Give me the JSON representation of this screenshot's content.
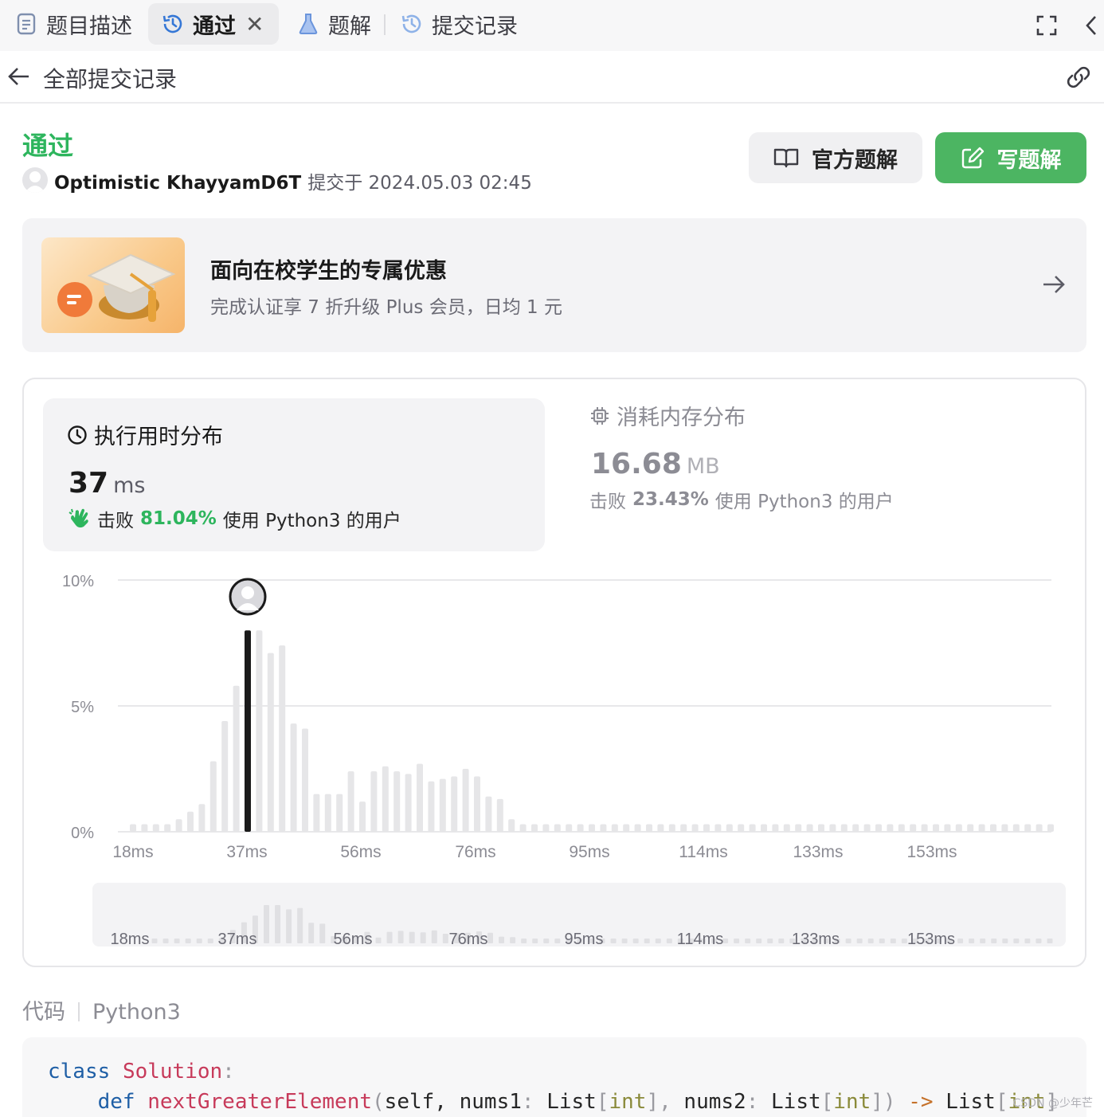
{
  "tabs": [
    {
      "label": "题目描述",
      "icon": "document-icon"
    },
    {
      "label": "通过",
      "icon": "history-icon",
      "active": true,
      "closable": true
    },
    {
      "label": "题解",
      "icon": "flask-icon"
    },
    {
      "label": "提交记录",
      "icon": "history-icon"
    }
  ],
  "header": {
    "title": "全部提交记录"
  },
  "submission": {
    "status": "通过",
    "user": "Optimistic KhayyamD6T",
    "submitted_label": "提交于 2024.05.03 02:45"
  },
  "buttons": {
    "official": "官方题解",
    "write": "写题解"
  },
  "promo": {
    "title": "面向在校学生的专属优惠",
    "subtitle": "完成认证享 7 折升级 Plus 会员，日均 1 元"
  },
  "runtime": {
    "title": "执行用时分布",
    "value": "37",
    "unit": "ms",
    "beat_prefix": "击败",
    "beat_pct": "81.04%",
    "beat_suffix": "使用 Python3 的用户"
  },
  "memory": {
    "title": "消耗内存分布",
    "value": "16.68",
    "unit": "MB",
    "beat_prefix": "击败",
    "beat_pct": "23.43%",
    "beat_suffix": "使用 Python3 的用户"
  },
  "colors": {
    "accent_green": "#2db55d",
    "button_green": "#4cb562",
    "selected_bar": "#1a1a1a",
    "bar": "#e6e6e8"
  },
  "chart_data": {
    "type": "bar",
    "title": "",
    "xlabel": "",
    "ylabel": "",
    "y_ticks": [
      "10%",
      "5%",
      "0%"
    ],
    "ylim": [
      0,
      10
    ],
    "x_tick_labels": [
      "18ms",
      "37ms",
      "56ms",
      "76ms",
      "95ms",
      "114ms",
      "133ms",
      "153ms"
    ],
    "selected_index": 10,
    "values": [
      0.3,
      0.3,
      0.3,
      0.3,
      0.5,
      0.8,
      1.1,
      2.8,
      4.4,
      5.8,
      8.0,
      8.0,
      7.1,
      7.4,
      4.3,
      4.1,
      1.5,
      1.5,
      1.5,
      2.4,
      1.2,
      2.4,
      2.6,
      2.4,
      2.3,
      2.7,
      2.0,
      2.1,
      2.2,
      2.5,
      2.2,
      1.4,
      1.3,
      0.5,
      0.3,
      0.3,
      0.3,
      0.3,
      0.3,
      0.3,
      0.3,
      0.3,
      0.3,
      0.3,
      0.3,
      0.3,
      0.3,
      0.3,
      0.3,
      0.3,
      0.3,
      0.3,
      0.3,
      0.3,
      0.3,
      0.3,
      0.3,
      0.3,
      0.3,
      0.3,
      0.3,
      0.3,
      0.3,
      0.3,
      0.3,
      0.3,
      0.3,
      0.3,
      0.3,
      0.3,
      0.3,
      0.3,
      0.3,
      0.3,
      0.3,
      0.3,
      0.3,
      0.3,
      0.3,
      0.3,
      0.3
    ]
  },
  "code": {
    "heading": "代码",
    "language": "Python3",
    "line1": {
      "kw": "class",
      "name": "Solution",
      "colon": ":"
    },
    "line2": {
      "kw": "def",
      "fn": "nextGreaterElement",
      "p1": "(",
      "self": "self,",
      "arg1": "nums1",
      "c1": ":",
      "t1": "List",
      "b1": "[",
      "int1": "int",
      "b2": "],",
      "arg2": "nums2",
      "c2": ":",
      "t2": "List",
      "b3": "[",
      "int2": "int",
      "b4": "])",
      "arrow": "->",
      "t3": "List",
      "b5": "[",
      "int3": "int",
      "b6": "]"
    }
  },
  "watermark": "CSDN @少年芒"
}
